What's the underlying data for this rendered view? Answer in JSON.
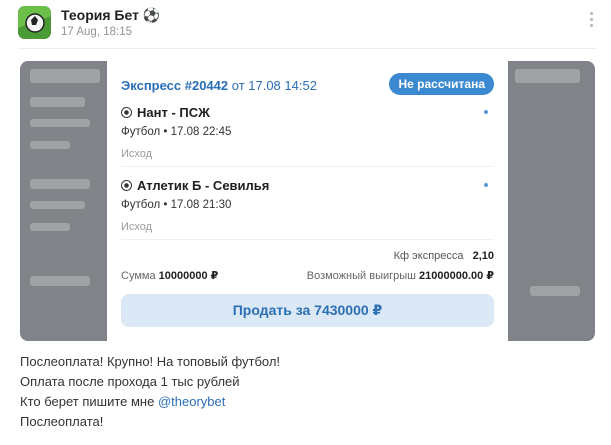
{
  "post": {
    "channel_name": "Теория Бет",
    "channel_emoji": "⚽",
    "time": "17 Aug, 18:15",
    "avatar_icon": "channel-avatar"
  },
  "ticket": {
    "title": "Экспресс #20442",
    "date": "от 17.08 14:52",
    "status": "Не рассчитана",
    "events": [
      {
        "title": "Нант - ПСЖ",
        "sub": "Футбол • 17.08 22:45",
        "outcome": "Исход"
      },
      {
        "title": "Атлетик Б - Севилья",
        "sub": "Футбол • 17.08 21:30",
        "outcome": "Исход"
      }
    ],
    "coef_label": "Кф экспресса",
    "coef_value": "2,10",
    "sum_label": "Сумма",
    "sum_value": "10000000 ₽",
    "win_label": "Возможный выигрыш",
    "win_value": "21000000.00 ₽",
    "sell_button": "Продать за 7430000 ₽"
  },
  "text": {
    "line1": "Послеоплата! Крупно! На топовый футбол!",
    "line2": "Оплата после прохода 1 тыс рублей",
    "line3_prefix": "Кто берет пишите мне ",
    "line3_mention": "@theorybet",
    "line4": "Послеоплата!"
  },
  "colors": {
    "accent": "#2b6fb6",
    "status_bg": "#3b89d0",
    "sell_bg": "#dbe8f5"
  }
}
